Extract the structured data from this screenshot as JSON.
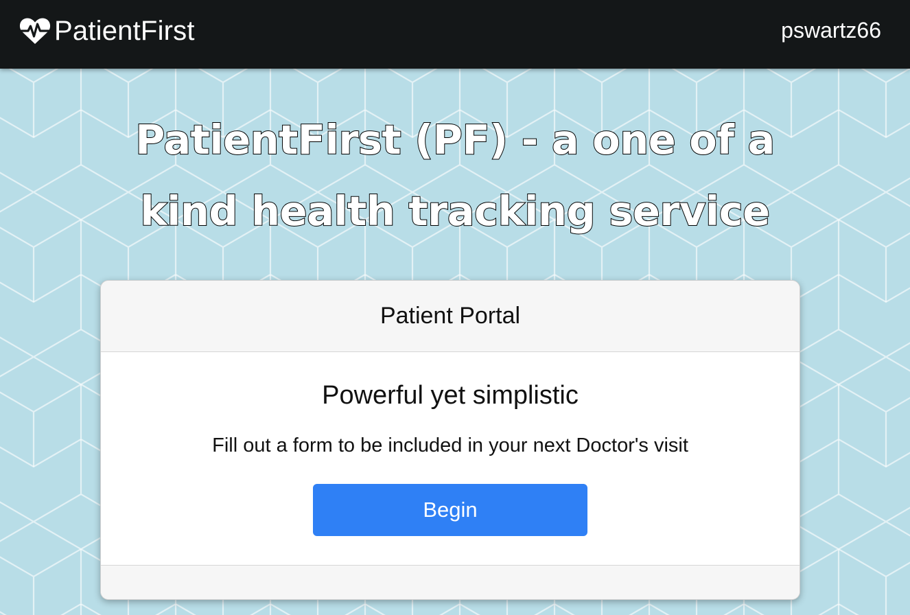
{
  "navbar": {
    "brand_icon": "heart-pulse-icon",
    "brand": "PatientFirst",
    "username": "pswartz66"
  },
  "hero": {
    "line1": "PatientFirst (PF) - a one of a",
    "line2": "kind health tracking service"
  },
  "card": {
    "header": "Patient Portal",
    "title": "Powerful yet simplistic",
    "text": "Fill out a form to be included in your next Doctor's visit",
    "button_label": "Begin"
  },
  "colors": {
    "navbar_bg": "#141718",
    "page_bg": "#b8dde7",
    "pattern_lines": "#ffffff",
    "button_bg": "#2f80f5",
    "card_header_bg": "#f6f6f6"
  }
}
